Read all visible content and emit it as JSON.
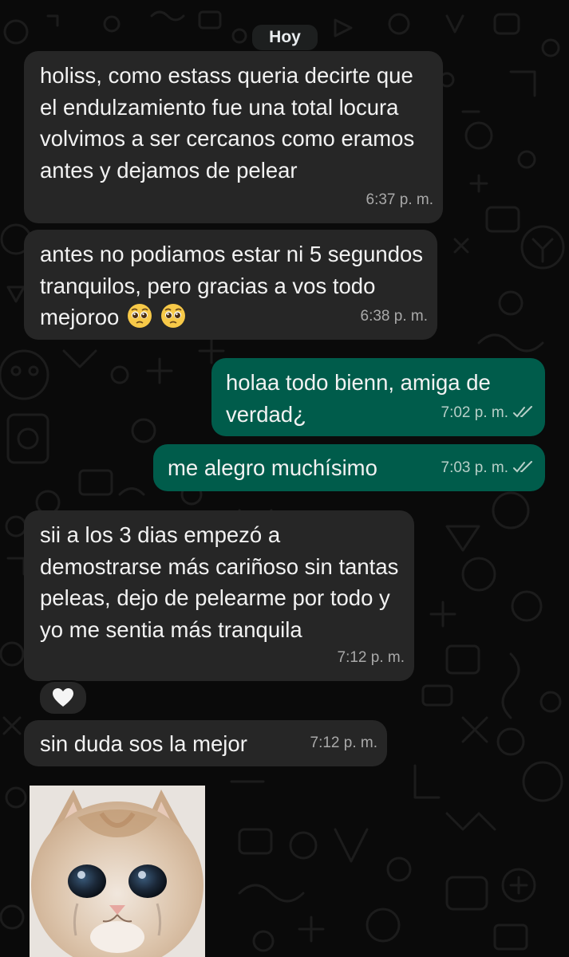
{
  "chat": {
    "date_label": "Hoy",
    "messages": [
      {
        "direction": "incoming",
        "text": "holiss, como estass queria decirte que el endulzamiento fue una total locura volvimos a ser cercanos como eramos antes y dejamos de pelear",
        "time": "6:37 p. m."
      },
      {
        "direction": "incoming",
        "text": "antes no podiamos estar ni 5 segundos tranquilos, pero gracias a vos todo mejoroo",
        "emoji": [
          "pleading-face-emoji",
          "pleading-face-emoji"
        ],
        "time": "6:38 p. m."
      },
      {
        "direction": "outgoing",
        "text": "holaa todo bienn, amiga de verdad¿",
        "time": "7:02 p. m.",
        "status_icon": "double-check-icon"
      },
      {
        "direction": "outgoing",
        "text": "me alegro muchísimo",
        "time": "7:03 p. m.",
        "status_icon": "double-check-icon"
      },
      {
        "direction": "incoming",
        "text": "sii a los 3 dias empezó a demostrarse más cariñoso sin tantas peleas, dejo de pelearme por todo y yo me sentia más tranquila",
        "time": "7:12 p. m.",
        "reaction": "white-heart-icon"
      },
      {
        "direction": "incoming",
        "text": "sin duda sos la mejor",
        "time": "7:12 p. m."
      },
      {
        "direction": "incoming",
        "type": "image",
        "image_subject": "crying-kitten-photo"
      }
    ]
  },
  "colors": {
    "background": "#0a0a0a",
    "incoming_bubble": "#262626",
    "outgoing_bubble": "#005c4b",
    "text": "#f2f2f2",
    "timestamp": "#a9a9a9"
  }
}
